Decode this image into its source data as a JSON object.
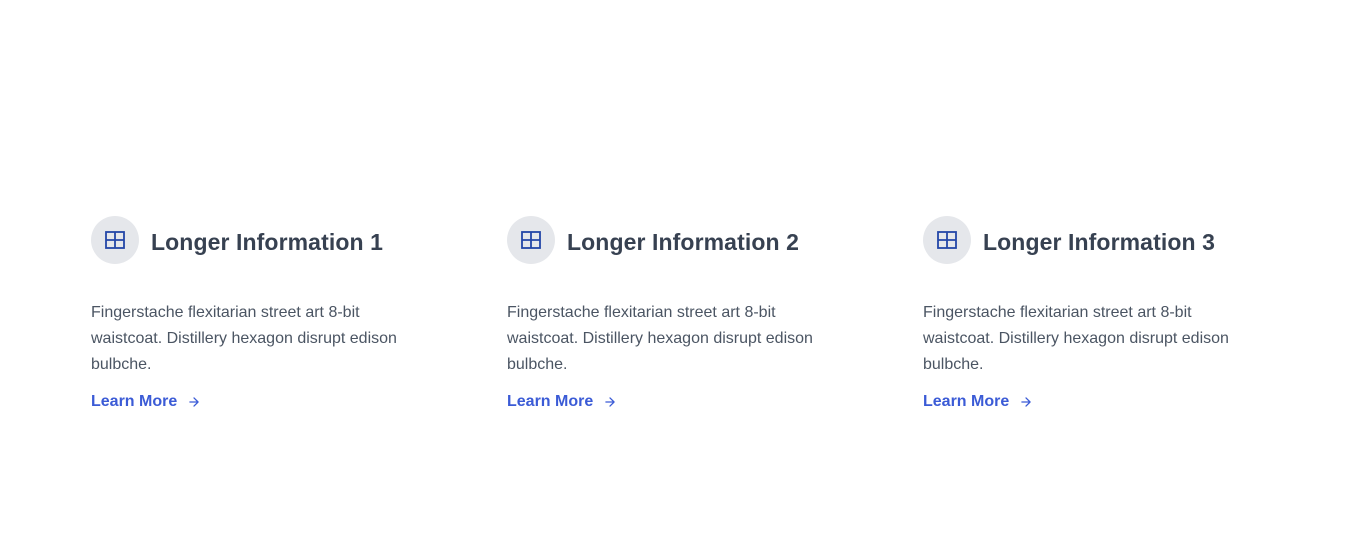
{
  "features": [
    {
      "title": "Longer Information 1",
      "description": "Fingerstache flexitarian street art 8-bit waistcoat. Distillery hexagon disrupt edison bulbche.",
      "link_label": "Learn More",
      "icon": "grid-icon",
      "link_icon": "arrow-right-icon"
    },
    {
      "title": "Longer Information 2",
      "description": "Fingerstache flexitarian street art 8-bit waistcoat. Distillery hexagon disrupt edison bulbche.",
      "link_label": "Learn More",
      "icon": "grid-icon",
      "link_icon": "arrow-right-icon"
    },
    {
      "title": "Longer Information 3",
      "description": "Fingerstache flexitarian street art 8-bit waistcoat. Distillery hexagon disrupt edison bulbche.",
      "link_label": "Learn More",
      "icon": "grid-icon",
      "link_icon": "arrow-right-icon"
    }
  ],
  "colors": {
    "accent": "#3b5bd6",
    "icon_color": "#2346a8",
    "icon_background": "#e5e7eb",
    "title": "#374151",
    "body_text": "#4b5563"
  }
}
